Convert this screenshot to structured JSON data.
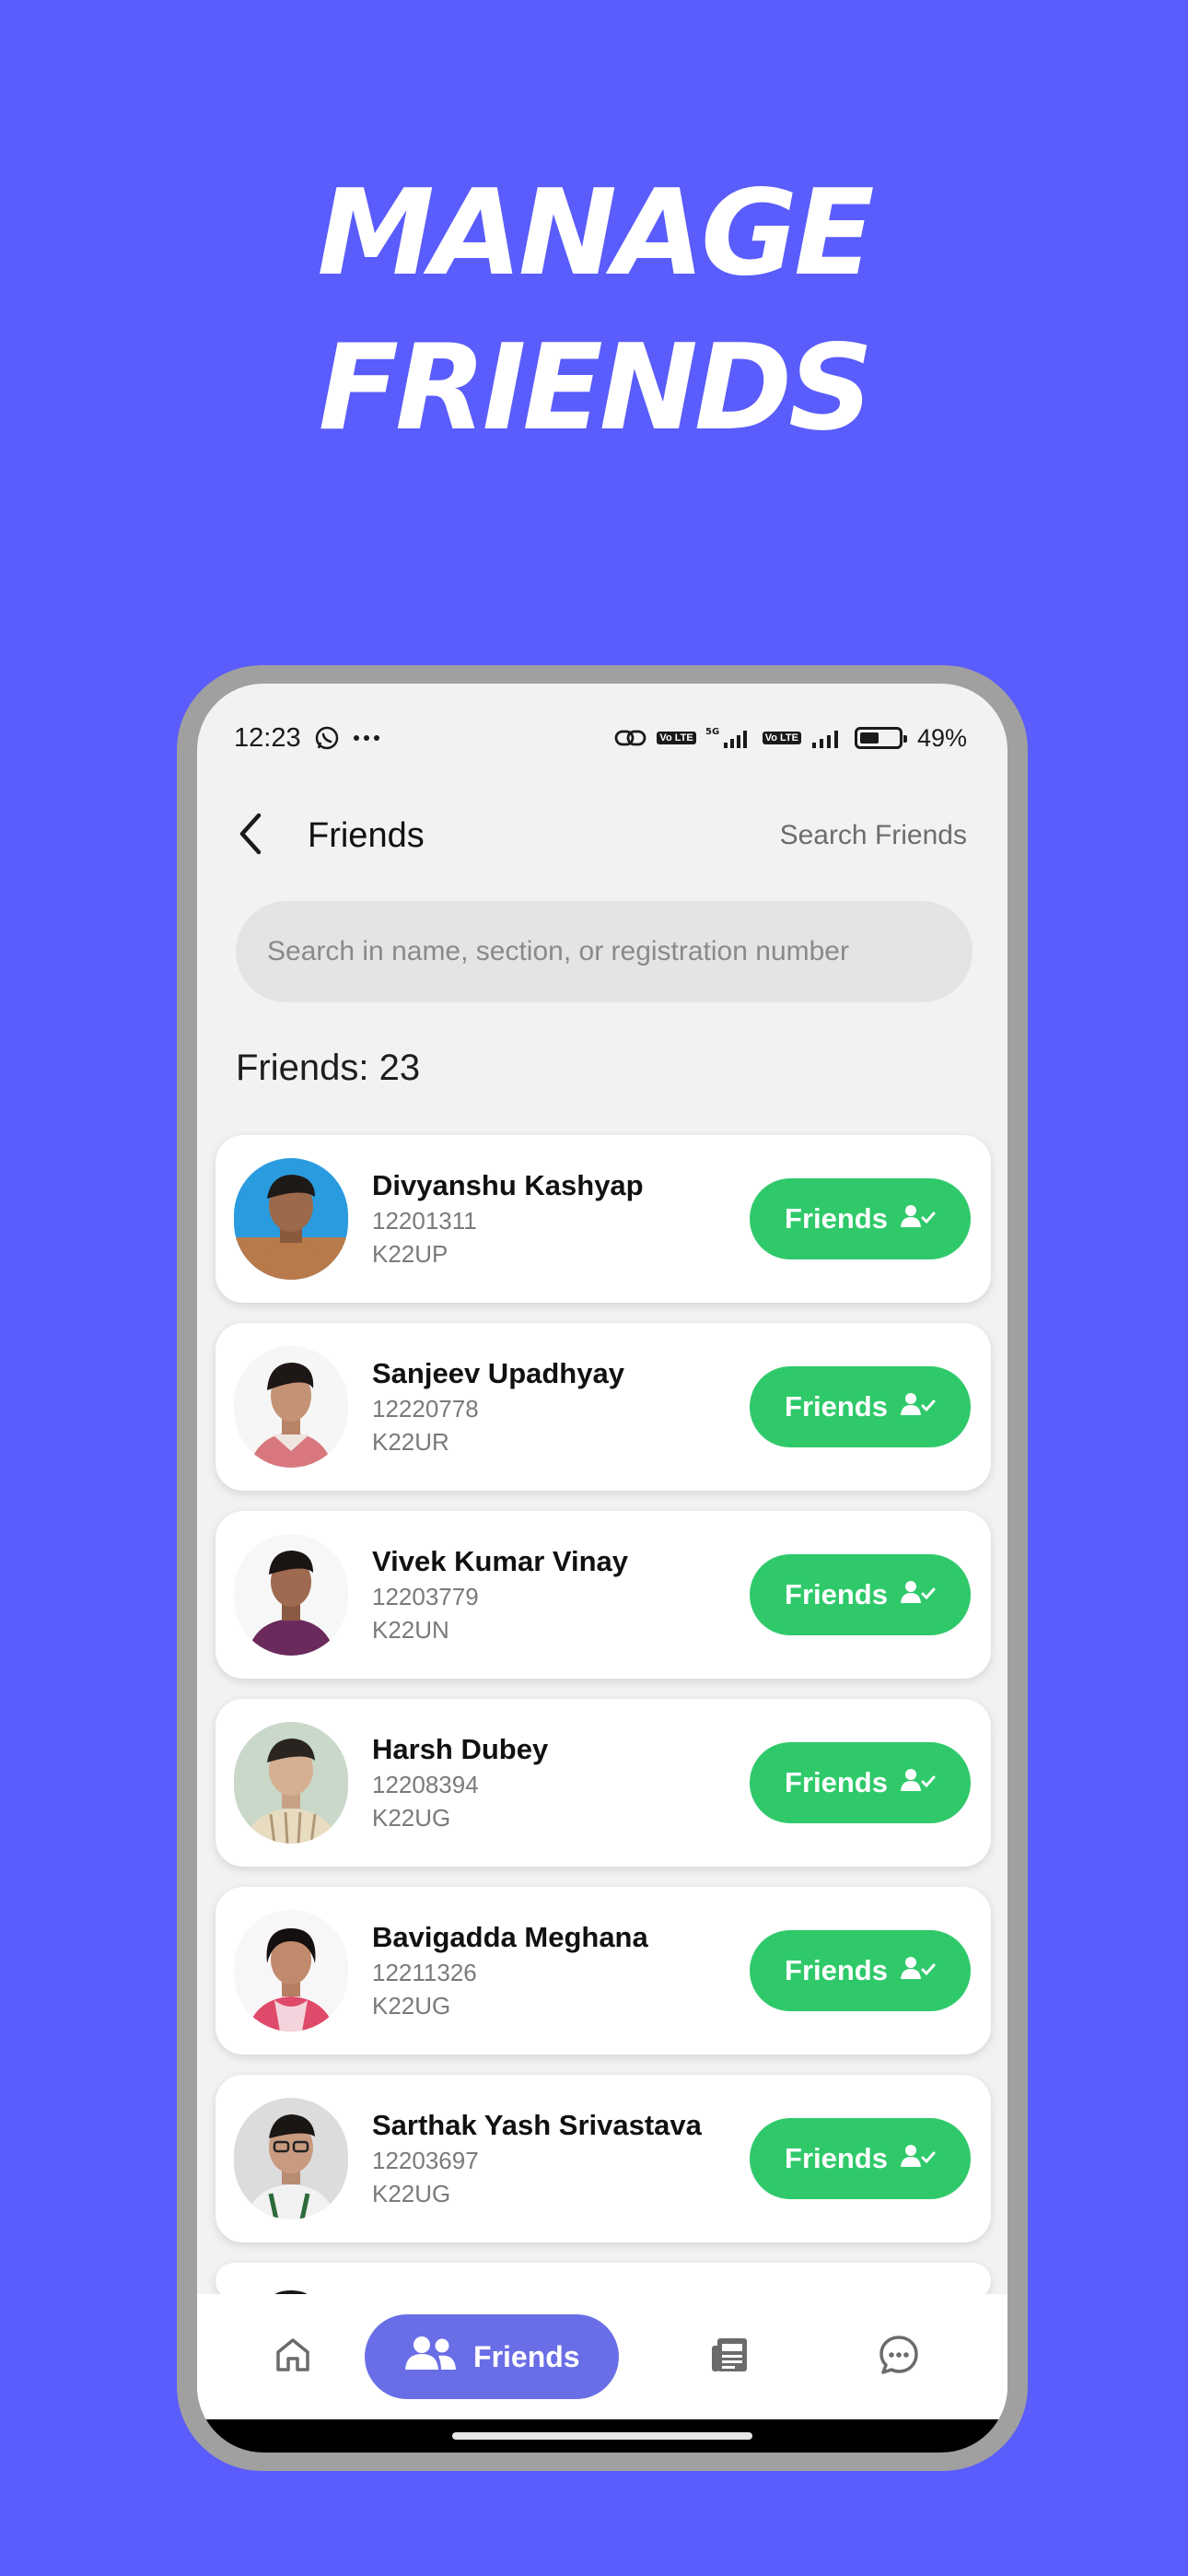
{
  "promo": {
    "headline_line1": "MANAGE",
    "headline_line2": "FRIENDS"
  },
  "status_bar": {
    "time": "12:23",
    "network": "5G",
    "volte": "Vo LTE",
    "battery_percent": "49%",
    "battery_level": 0.49,
    "icons": [
      "whatsapp-icon",
      "more-dots-icon",
      "link-icon",
      "signal-icon",
      "battery-icon"
    ]
  },
  "header": {
    "title": "Friends",
    "action_label": "Search Friends",
    "back_icon": "chevron-left-icon"
  },
  "search": {
    "placeholder": "Search in name, section, or registration number",
    "value": ""
  },
  "friends_count_label": "Friends: 23",
  "friends": [
    {
      "name": "Divyanshu Kashyap",
      "reg": "12201311",
      "section": "K22UP",
      "button": "Friends"
    },
    {
      "name": "Sanjeev Upadhyay",
      "reg": "12220778",
      "section": "K22UR",
      "button": "Friends"
    },
    {
      "name": "Vivek Kumar Vinay",
      "reg": "12203779",
      "section": "K22UN",
      "button": "Friends"
    },
    {
      "name": "Harsh Dubey",
      "reg": "12208394",
      "section": "K22UG",
      "button": "Friends"
    },
    {
      "name": "Bavigadda Meghana",
      "reg": "12211326",
      "section": "K22UG",
      "button": "Friends"
    },
    {
      "name": "Sarthak Yash Srivastava",
      "reg": "12203697",
      "section": "K22UG",
      "button": "Friends"
    }
  ],
  "bottom_nav": {
    "items": [
      {
        "id": "home",
        "icon": "home-icon",
        "label": ""
      },
      {
        "id": "friends",
        "icon": "users-icon",
        "label": "Friends",
        "active": true
      },
      {
        "id": "news",
        "icon": "newspaper-icon",
        "label": ""
      },
      {
        "id": "chat",
        "icon": "chat-icon",
        "label": ""
      }
    ]
  },
  "colors": {
    "background": "#5a5cfb",
    "accent_green": "#2fc96a",
    "nav_active": "#6a6ee6",
    "phone_frame": "#a0a0a0"
  }
}
